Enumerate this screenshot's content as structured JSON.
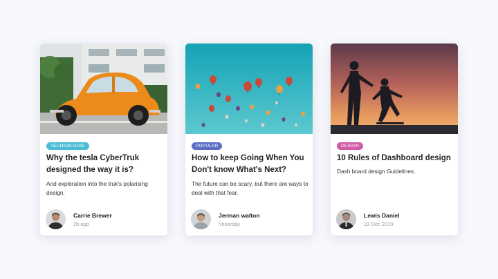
{
  "colors": {
    "background": "#f7f8fc",
    "tag_technologie": "#47bcd4",
    "tag_popular": "#5b6fc7",
    "tag_design": "#d25aa6"
  },
  "cards": [
    {
      "image_icon": "orange-beetle-car-photo",
      "tag": "TECHNOLOGIE",
      "title": "Why the tesla CyberTruk designed the way it is?",
      "description": "And exploration into the truk's polarising design.",
      "author": {
        "name": "Carrie Brewer",
        "date": "2h ago"
      }
    },
    {
      "image_icon": "hot-air-balloons-photo",
      "tag": "POPULAR",
      "title": "How to keep Going When You Don't know What's Next?",
      "description": "The future can be scary, but there are ways to deal with that fear.",
      "author": {
        "name": "Jerman walton",
        "date": "Yeserday"
      }
    },
    {
      "image_icon": "skateboarders-sunset-photo",
      "tag": "DESIGN",
      "title": "10 Rules of Dashboard design",
      "description": "Dash board design Guidelines.",
      "author": {
        "name": "Lewis Daniel",
        "date": "23 Dec 2019"
      }
    }
  ]
}
